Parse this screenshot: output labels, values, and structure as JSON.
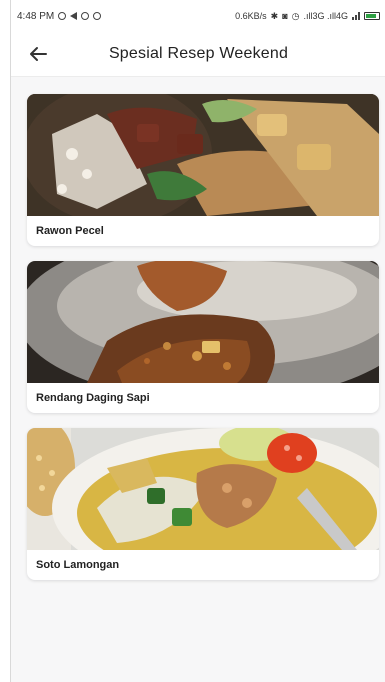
{
  "status_bar": {
    "time": "4:48 PM",
    "network_speed": "0.6KB/s",
    "signal_text": ".ıll3G .ıll4G"
  },
  "app_bar": {
    "title": "Spesial Resep Weekend",
    "back_icon": "arrow-left-icon"
  },
  "recipes": [
    {
      "name": "Rawon Pecel"
    },
    {
      "name": "Rendang Daging Sapi"
    },
    {
      "name": "Soto Lamongan"
    }
  ],
  "colors": {
    "background": "#f7f7f8",
    "card": "#ffffff",
    "text": "#222222"
  }
}
